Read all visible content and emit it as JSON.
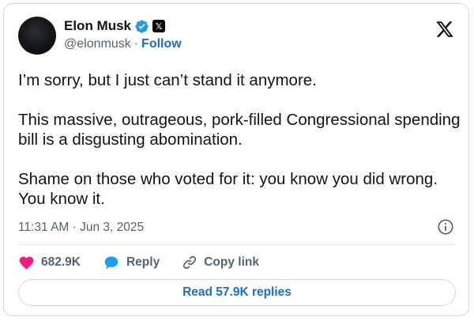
{
  "author": {
    "display_name": "Elon Musk",
    "handle": "@elonmusk",
    "separator": "·",
    "follow_label": "Follow",
    "verified_icon": "verified-badge-icon",
    "affiliate_badge_text": "𝕏"
  },
  "tweet": {
    "paragraphs": [
      "I’m sorry, but I just can’t stand it anymore.",
      "This massive, outrageous, pork-filled Congressional spending bill is a disgusting abomination.",
      "Shame on those who voted for it: you know you did wrong. You know it."
    ],
    "timestamp": "11:31 AM · Jun 3, 2025"
  },
  "actions": {
    "likes": "682.9K",
    "reply_label": "Reply",
    "copy_link_label": "Copy link"
  },
  "read_replies_label": "Read 57.9K replies",
  "colors": {
    "link": "#1d6ebf",
    "like": "#f91880",
    "reply": "#1d9bf0",
    "verified": "#1d9bf0",
    "muted": "#536471",
    "border": "#cfd9de"
  }
}
